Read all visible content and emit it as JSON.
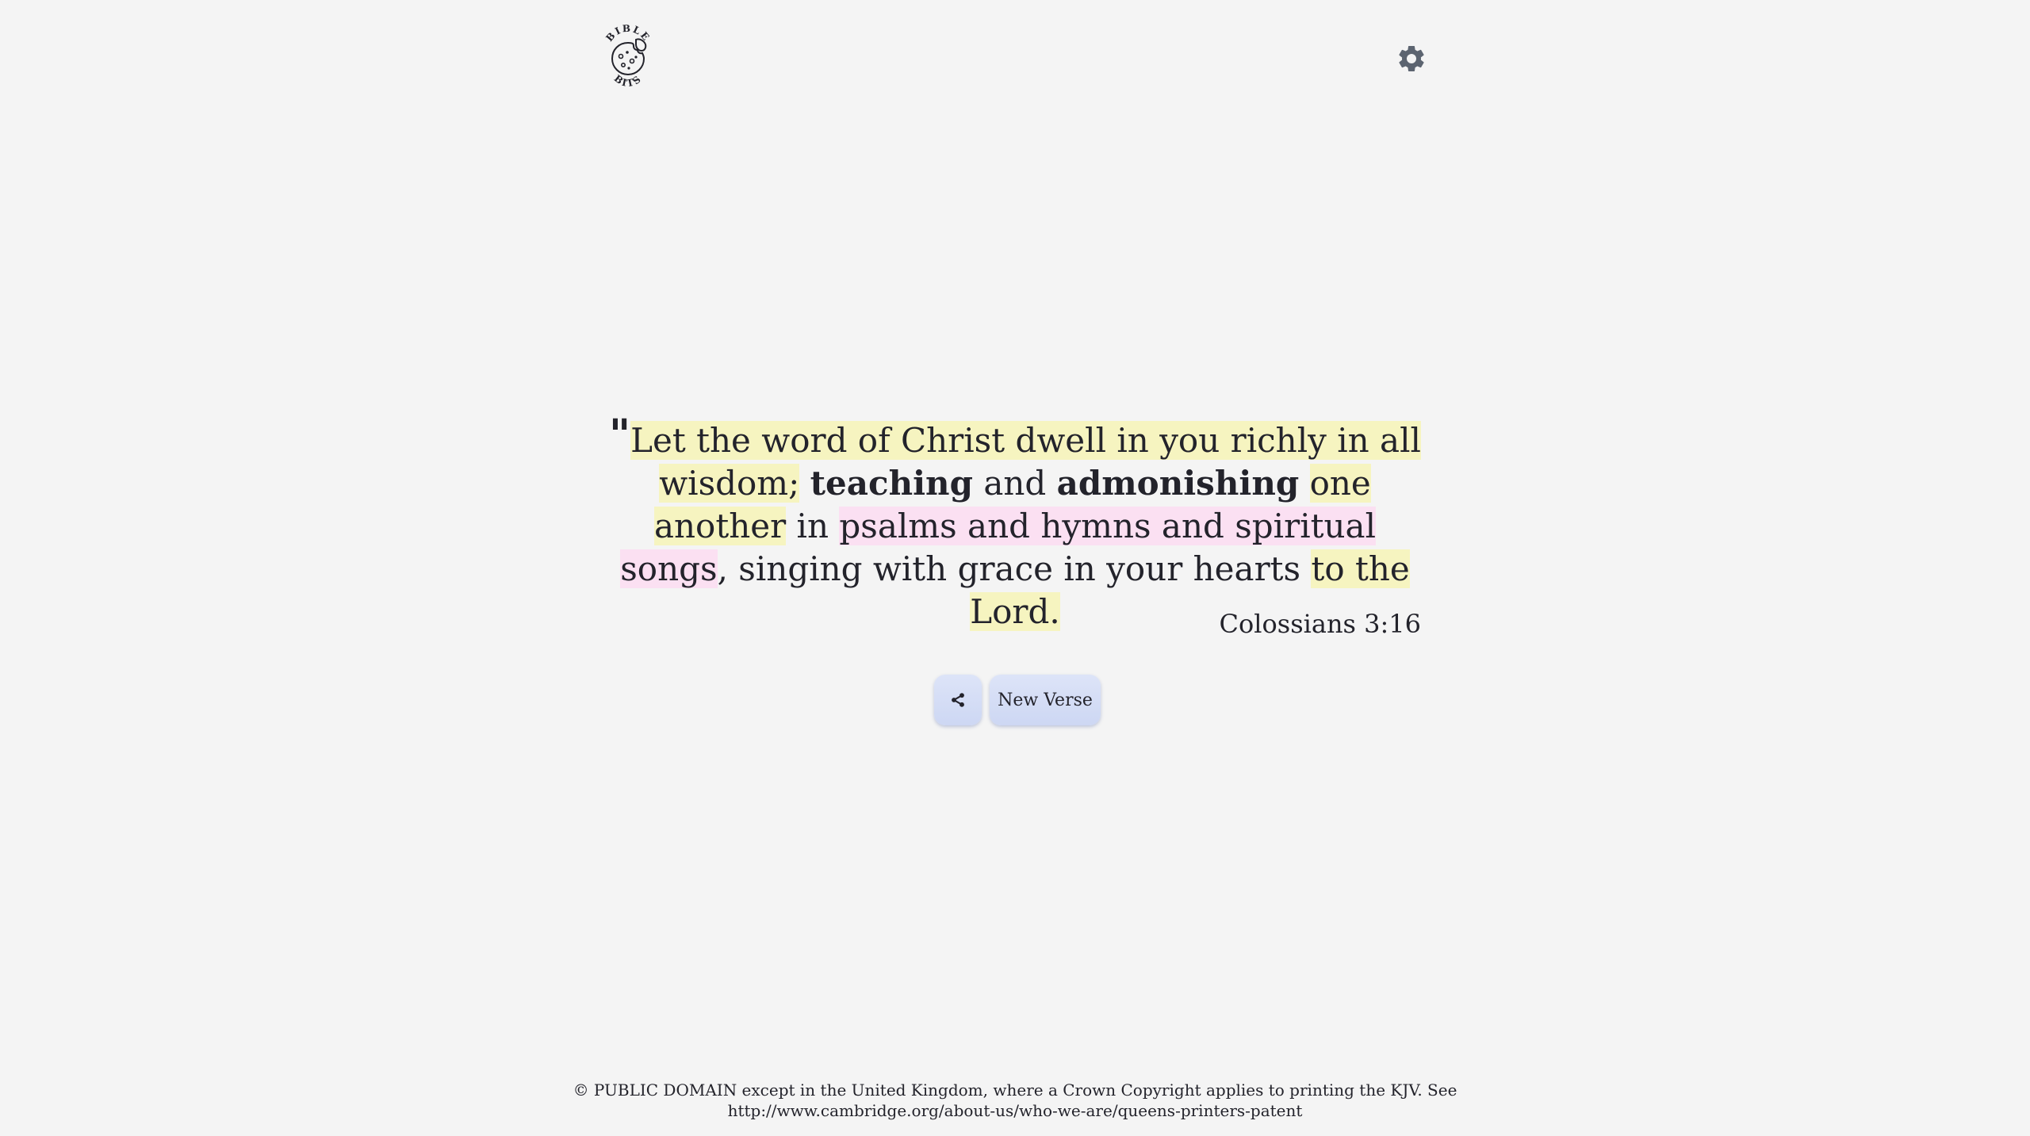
{
  "header": {
    "logo": {
      "top_text": "BIBLE",
      "bottom_text": "BITS",
      "icon": "cookie-icon"
    },
    "settings": {
      "icon": "gear-icon",
      "color": "#5c6470"
    }
  },
  "verse": {
    "quote_mark": "\"",
    "segments": [
      {
        "text": "Let the word of Christ dwell in you richly in all wisdom;",
        "highlight": "yellow"
      },
      {
        "text": " "
      },
      {
        "text": "teaching",
        "style": "bold"
      },
      {
        "text": " and "
      },
      {
        "text": "admonishing",
        "style": "bold"
      },
      {
        "text": " "
      },
      {
        "text": "one another",
        "highlight": "yellow"
      },
      {
        "text": " in "
      },
      {
        "text": "psalms and hymns and spiritual songs",
        "highlight": "pink"
      },
      {
        "text": ", singing with grace in your hearts "
      },
      {
        "text": "to the Lord.",
        "highlight": "yellow"
      }
    ],
    "reference": "Colossians 3:16"
  },
  "actions": {
    "share_icon": "share-icon",
    "new_verse_label": "New Verse"
  },
  "footer": {
    "line1": "© PUBLIC DOMAIN except in the United Kingdom, where a Crown Copyright applies to printing the KJV. See",
    "line2": "http://www.cambridge.org/about-us/who-we-are/queens-printers-patent"
  },
  "colors": {
    "background": "#f4f4f4",
    "text": "#23232b",
    "highlight_yellow": "#f6f4c0",
    "highlight_pink": "#fbe0f2",
    "button": "#d4ddf5"
  }
}
